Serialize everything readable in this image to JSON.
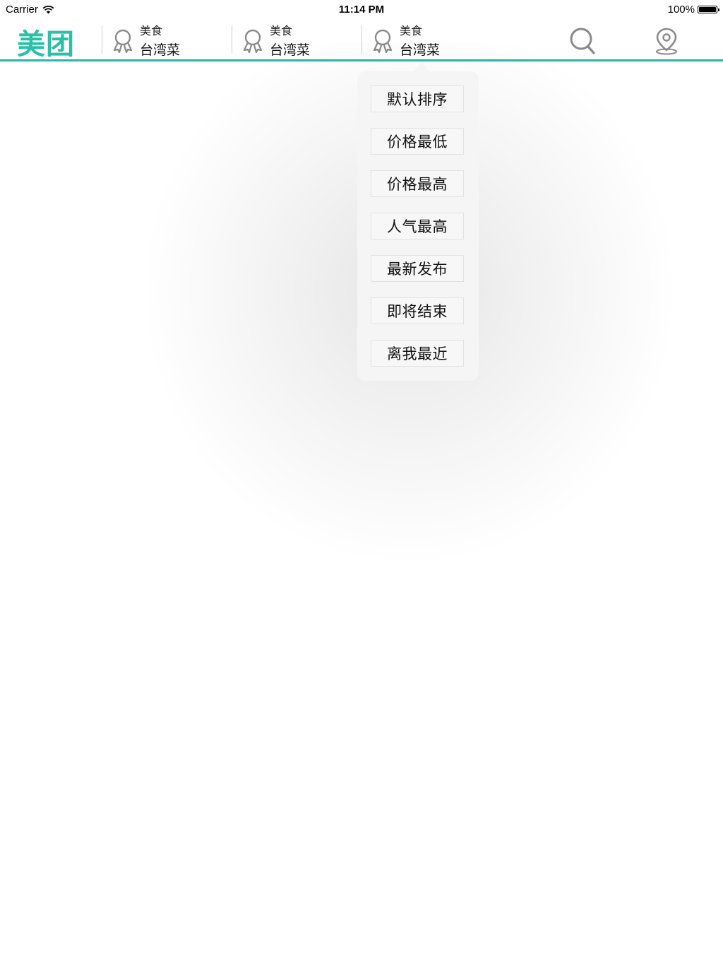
{
  "status_bar": {
    "carrier": "Carrier",
    "time": "11:14 PM",
    "battery": "100%"
  },
  "nav": {
    "logo": "美团",
    "categories": [
      {
        "top": "美食",
        "bottom": "台湾菜",
        "icon": "award-icon"
      },
      {
        "top": "美食",
        "bottom": "台湾菜",
        "icon": "award-icon"
      },
      {
        "top": "美食",
        "bottom": "台湾菜",
        "icon": "award-icon"
      }
    ],
    "search_icon": "search-icon",
    "location_icon": "map-pin-icon",
    "accent_color": "#2bb5a3"
  },
  "sort_menu": {
    "options": [
      "默认排序",
      "价格最低",
      "价格最高",
      "人气最高",
      "最新发布",
      "即将结束",
      "离我最近"
    ]
  }
}
